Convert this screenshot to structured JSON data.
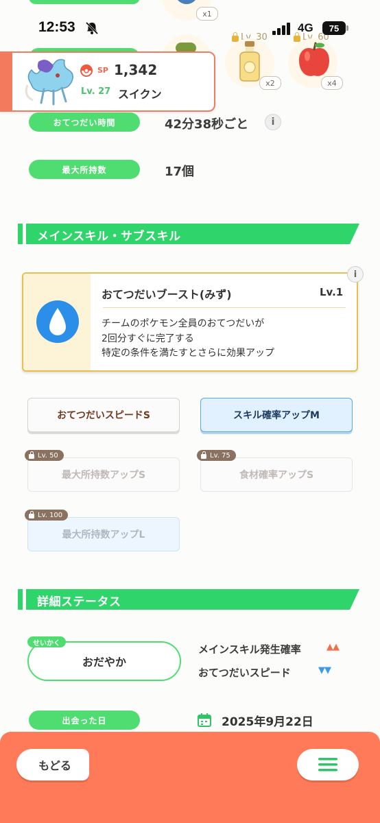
{
  "status_bar": {
    "time": "12:53",
    "network": "4G",
    "battery": "75"
  },
  "ingredients": [
    {
      "count": "x1"
    },
    {
      "level_lock": "Lv. 30",
      "count": "x2"
    },
    {
      "level_lock": "Lv. 60",
      "count": "x4"
    }
  ],
  "pokemon": {
    "sp_label": "SP",
    "sp_value": "1,342",
    "level": "Lv. 27",
    "name": "スイクン"
  },
  "stats": [
    {
      "label": "おてつだい時間",
      "value": "42分38秒ごと"
    },
    {
      "label": "最大所持数",
      "value": "17個"
    }
  ],
  "skills_section": {
    "title": "メインスキル・サブスキル"
  },
  "main_skill": {
    "name": "おてつだいブースト(みず)",
    "level": "Lv.1",
    "desc_lines": [
      "チームのポケモン全員のおてつだいが",
      "2回分すぐに完了する",
      "特定の条件を満たすとさらに効果アップ"
    ]
  },
  "sub_skills": [
    {
      "label": "おてつだいスピードS"
    },
    {
      "label": "スキル確率アップM"
    },
    {
      "lock": "Lv. 50",
      "label": "最大所持数アップS"
    },
    {
      "lock": "Lv. 75",
      "label": "食材確率アップS"
    },
    {
      "lock": "Lv. 100",
      "label": "最大所持数アップL"
    }
  ],
  "detail_section": {
    "title": "詳細ステータス"
  },
  "nature": {
    "tag": "せいかく",
    "value": "おだやか",
    "effects": [
      {
        "label": "メインスキル発生確率",
        "arrows": "▲▲"
      },
      {
        "label": "おてつだいスピード",
        "arrows": "▼▼"
      }
    ]
  },
  "met_date": {
    "label": "出会った日",
    "value": "2025年9月22日"
  },
  "bottom_nav": {
    "back_label": "もどる"
  },
  "colors": {
    "green": "#4fdd72",
    "orange": "#ff7a58",
    "up": "#f07050",
    "down": "#3a9be8"
  }
}
